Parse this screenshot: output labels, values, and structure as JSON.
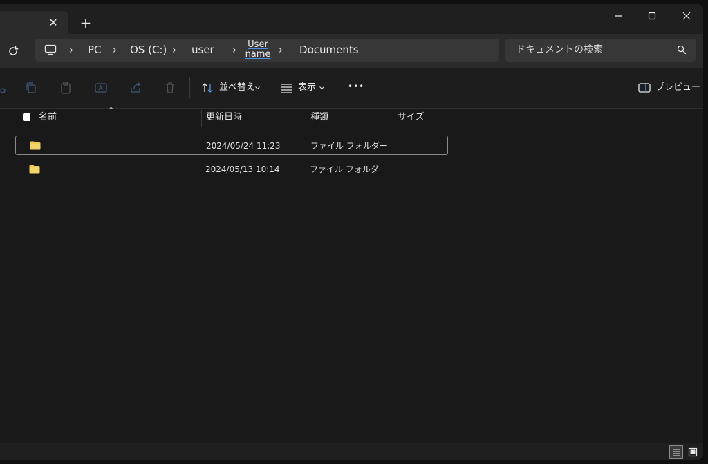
{
  "tabs": {
    "new_tab": "+",
    "close": "✕"
  },
  "window_controls": {
    "minimize": "—",
    "maximize": "☐",
    "close": "✕"
  },
  "address": {
    "crumbs": [
      "PC",
      "OS (C:)",
      "user",
      "Documents"
    ],
    "user_name_line1": "User",
    "user_name_line2": "name",
    "separator": "›"
  },
  "search": {
    "placeholder": "ドキュメントの検索"
  },
  "toolbar": {
    "sort_label": "並べ替え",
    "view_label": "表示",
    "more_label": "•••",
    "preview_label": "プレビュー"
  },
  "columns": {
    "name": "名前",
    "modified": "更新日時",
    "type": "種類",
    "size": "サイズ"
  },
  "rows": [
    {
      "name": "",
      "modified": "2024/05/24 11:23",
      "type": "ファイル フォルダー",
      "size": ""
    },
    {
      "name": "",
      "modified": "2024/05/13 10:14",
      "type": "ファイル フォルダー",
      "size": ""
    }
  ],
  "colors": {
    "folder": "#f2c94c",
    "accent_underline": "#4f8fe6",
    "background": "#191919"
  }
}
